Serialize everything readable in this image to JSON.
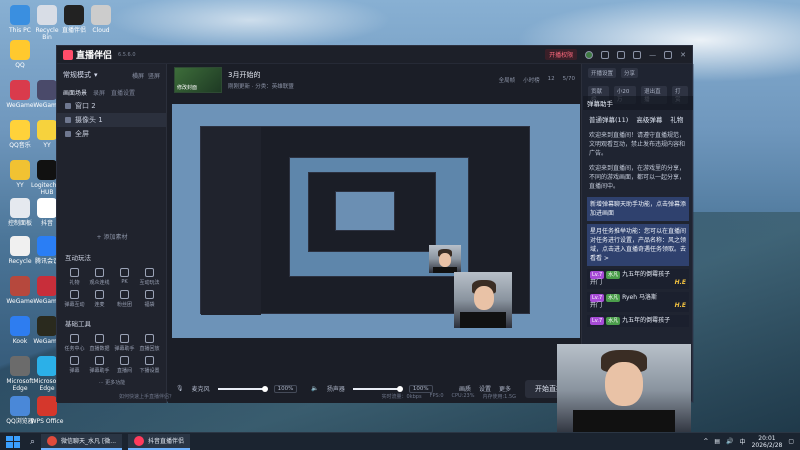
{
  "desktop": {
    "icons": [
      "This PC",
      "Recycle Bin",
      "直播伴侣",
      "Cloud",
      "QQ",
      "YY",
      "Logitech G HUB",
      "抖音",
      "控制面板",
      "腾讯会议",
      "WeGame",
      "QQ音乐",
      "Kook",
      "Microsoft Edge",
      "WPS Office",
      "QQ浏览器",
      "Recycle"
    ]
  },
  "taskbar": {
    "search_icon": "search-icon",
    "apps": [
      {
        "label": "微信聊天_水凡 [微...",
        "color": "#e04b3c"
      },
      {
        "label": "抖音直播伴侣",
        "color": "#ff3b5c"
      }
    ],
    "time": "20:01",
    "date": "2026/2/28",
    "tray_lang": "中"
  },
  "window": {
    "app_name": "直播伴侣",
    "version": "6.5.6.0",
    "live_badge": "开播权限",
    "header_right": [
      "开播设置",
      "分享",
      "贡献榜",
      "小20万",
      "退出直播",
      "打赏"
    ],
    "left": {
      "mode": "常规模式",
      "mode_right": [
        "横屏",
        "竖屏"
      ],
      "scene_tabs": [
        "画面场景",
        "录屏",
        "直播设置"
      ],
      "scenes": [
        "窗口 2",
        "摄像头 1",
        "全屏"
      ],
      "add_source": "+ 添加素材",
      "interact_title": "互动玩法",
      "interact_tools": [
        "礼物",
        "观众连线",
        "PK",
        "互动玩法",
        "弹幕互动",
        "连麦",
        "粉丝团",
        "福袋"
      ],
      "basic_title": "基础工具",
      "basic_tools": [
        "任务中心",
        "直播数据",
        "弹幕助手",
        "直播回放",
        "弹幕",
        "弹幕助手",
        "直播间",
        "下播设置"
      ],
      "more": "··· 更多功能"
    },
    "center": {
      "game_title": "3月开始的",
      "game_sub": "刚刚更新 · 分类：英雄联盟",
      "cover_label": "修改封面",
      "head_right": [
        "全局帧",
        "小时榜",
        "12",
        "5/70"
      ],
      "mic_label": "麦克风",
      "mic_value": "100%",
      "speaker_label": "扬声器",
      "speaker_value": "100%",
      "tools": [
        "画质",
        "设置",
        "更多"
      ],
      "go_live": "开始直播",
      "status": [
        "如何快速上手直播伴侣？",
        "实时流量：0kbps",
        "FPS:0",
        "CPU:23%",
        "内存使用:1.5G"
      ]
    }
  },
  "danmaku": {
    "title": "弹幕助手",
    "tabs": [
      "普通弹幕(11)",
      "高级弹幕",
      "礼物"
    ],
    "lines": [
      "欢迎来到直播间！请遵守直播规范，文明观看互动，禁止发布违规内容和广告。",
      "欢迎来到直播间，在游戏里的分享，不同的游戏画面，都可以一起分享，直播间中。"
    ],
    "highlight1": "新增弹幕聊天助手功能，点击弹幕添加进画面",
    "highlight2": "星月任务推举功能：您可以在直播间对任务进行设置，产品名称：风之领域，点击进入直播奇遇任务领取。去看看 >",
    "users": [
      {
        "level": "Lv.7",
        "fan": "水凡",
        "name": "九五年的倒霉孩子",
        "text": "开门",
        "tag": "H.E"
      },
      {
        "level": "Lv.7",
        "fan": "水凡",
        "name": "Ryeh 马洛斯",
        "text": "开门",
        "tag": "H.E"
      },
      {
        "level": "Lv.7",
        "fan": "水凡",
        "name": "九五年的倒霉孩子",
        "text": "",
        "tag": ""
      }
    ]
  }
}
